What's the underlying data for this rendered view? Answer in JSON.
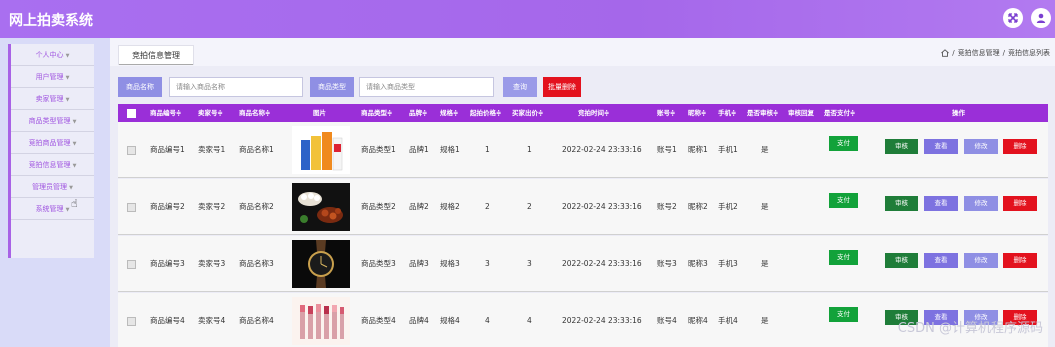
{
  "app": {
    "title": "网上拍卖系统"
  },
  "header_icons": [
    {
      "name": "expand-icon"
    },
    {
      "name": "user-icon"
    }
  ],
  "sidebar": {
    "items": [
      {
        "label": "个人中心"
      },
      {
        "label": "用户管理"
      },
      {
        "label": "卖家管理"
      },
      {
        "label": "商品类型管理"
      },
      {
        "label": "竞拍商品管理"
      },
      {
        "label": "竞拍信息管理"
      },
      {
        "label": "管理员管理"
      },
      {
        "label": "系统管理"
      }
    ]
  },
  "tab": {
    "label": "竞拍信息管理"
  },
  "breadcrumb": {
    "sep": "/",
    "level1": "竞拍信息管理",
    "level2": "竞拍信息列表"
  },
  "search": {
    "name_label": "商品名称",
    "name_placeholder": "请输入商品名称",
    "type_label": "商品类型",
    "type_placeholder": "请输入商品类型",
    "query_label": "查询",
    "batch_delete_label": "批量删除"
  },
  "table": {
    "headers": {
      "product_no": "商品编号",
      "seller_no": "卖家号",
      "product_name": "商品名称",
      "image": "图片",
      "product_type": "商品类型",
      "brand": "品牌",
      "spec": "规格",
      "start_price": "起拍价格",
      "seller_bid": "买家出价",
      "bid_time": "竞拍时间",
      "account": "账号",
      "nickname": "昵称",
      "phone": "手机",
      "audited": "是否审核",
      "audit_reply": "审核回复",
      "paid": "是否支付",
      "actions": "操作"
    },
    "sort_marker": "≑",
    "action_labels": {
      "pay": "支付",
      "audit": "审核",
      "view": "查看",
      "edit": "修改",
      "delete": "删除"
    },
    "rows": [
      {
        "product_no": "商品编号1",
        "seller_no": "卖家号1",
        "product_name": "商品名称1",
        "image_kind": "boxes",
        "product_type": "商品类型1",
        "brand": "品牌1",
        "spec": "规格1",
        "start_price": "1",
        "seller_bid": "1",
        "bid_time": "2022-02-24 23:33:16",
        "account": "账号1",
        "nickname": "昵称1",
        "phone": "手机1",
        "audited": "是",
        "audit_reply": "",
        "paid": ""
      },
      {
        "product_no": "商品编号2",
        "seller_no": "卖家号2",
        "product_name": "商品名称2",
        "image_kind": "food",
        "product_type": "商品类型2",
        "brand": "品牌2",
        "spec": "规格2",
        "start_price": "2",
        "seller_bid": "2",
        "bid_time": "2022-02-24 23:33:16",
        "account": "账号2",
        "nickname": "昵称2",
        "phone": "手机2",
        "audited": "是",
        "audit_reply": "",
        "paid": ""
      },
      {
        "product_no": "商品编号3",
        "seller_no": "卖家号3",
        "product_name": "商品名称3",
        "image_kind": "watch",
        "product_type": "商品类型3",
        "brand": "品牌3",
        "spec": "规格3",
        "start_price": "3",
        "seller_bid": "3",
        "bid_time": "2022-02-24 23:33:16",
        "account": "账号3",
        "nickname": "昵称3",
        "phone": "手机3",
        "audited": "是",
        "audit_reply": "",
        "paid": ""
      },
      {
        "product_no": "商品编号4",
        "seller_no": "卖家号4",
        "product_name": "商品名称4",
        "image_kind": "lipsticks",
        "product_type": "商品类型4",
        "brand": "品牌4",
        "spec": "规格4",
        "start_price": "4",
        "seller_bid": "4",
        "bid_time": "2022-02-24 23:33:16",
        "account": "账号4",
        "nickname": "昵称4",
        "phone": "手机4",
        "audited": "是",
        "audit_reply": "",
        "paid": ""
      }
    ]
  },
  "watermark": "CSDN @计算机程序源码",
  "colors": {
    "header_bg": "#a96ff0",
    "table_header": "#9a2fd8",
    "pay": "#12a23a",
    "audit": "#1f7d39",
    "view": "#7d72e0",
    "edit": "#8f8fe4",
    "delete": "#e3121e"
  }
}
